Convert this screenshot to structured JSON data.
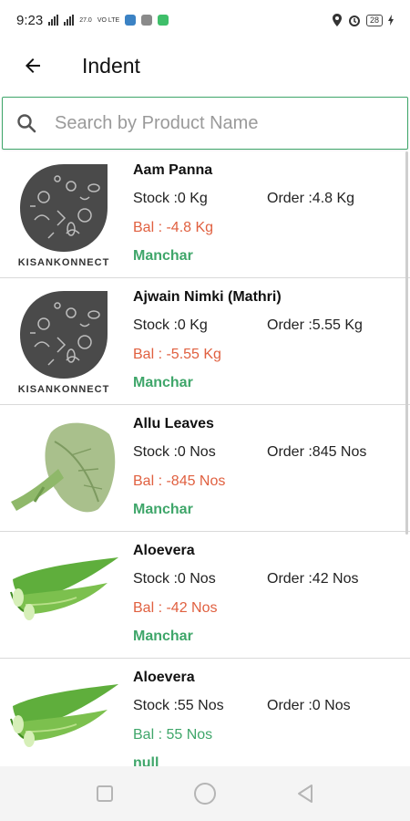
{
  "status_bar": {
    "time": "9:23",
    "network_small": "4G",
    "speed": "27.0",
    "speed_unit": "KB/S",
    "volte": "VO LTE",
    "battery": "28"
  },
  "header": {
    "title": "Indent",
    "back_icon": "arrow-left-icon"
  },
  "search": {
    "placeholder": "Search by Product Name",
    "value": "",
    "icon": "search-icon"
  },
  "colors": {
    "accent_green": "#3fa66a",
    "negative_red": "#e06040"
  },
  "products": [
    {
      "name": "Aam Panna",
      "image": "kisankonnect-logo",
      "brand_text": "KISANKONNECT",
      "stock": "Stock :0 Kg",
      "order": "Order :4.8 Kg",
      "bal": "Bal : -4.8 Kg",
      "bal_sign": "negative",
      "location": "Manchar"
    },
    {
      "name": "Ajwain Nimki (Mathri)",
      "image": "kisankonnect-logo",
      "brand_text": "KISANKONNECT",
      "stock": "Stock :0 Kg",
      "order": "Order :5.55 Kg",
      "bal": "Bal : -5.55 Kg",
      "bal_sign": "negative",
      "location": "Manchar"
    },
    {
      "name": "Allu Leaves",
      "image": "leaf-image",
      "stock": "Stock :0 Nos",
      "order": "Order :845 Nos",
      "bal": "Bal : -845 Nos",
      "bal_sign": "negative",
      "location": "Manchar"
    },
    {
      "name": "Aloevera",
      "image": "aloevera-image",
      "stock": "Stock :0 Nos",
      "order": "Order :42 Nos",
      "bal": "Bal : -42 Nos",
      "bal_sign": "negative",
      "location": "Manchar"
    },
    {
      "name": "Aloevera",
      "image": "aloevera-image",
      "stock": "Stock :55 Nos",
      "order": "Order :0 Nos",
      "bal": "Bal : 55 Nos",
      "bal_sign": "positive",
      "location": "null"
    }
  ],
  "nav_bar": {
    "recents_icon": "square-icon",
    "home_icon": "circle-icon",
    "back_icon": "triangle-back-icon"
  }
}
